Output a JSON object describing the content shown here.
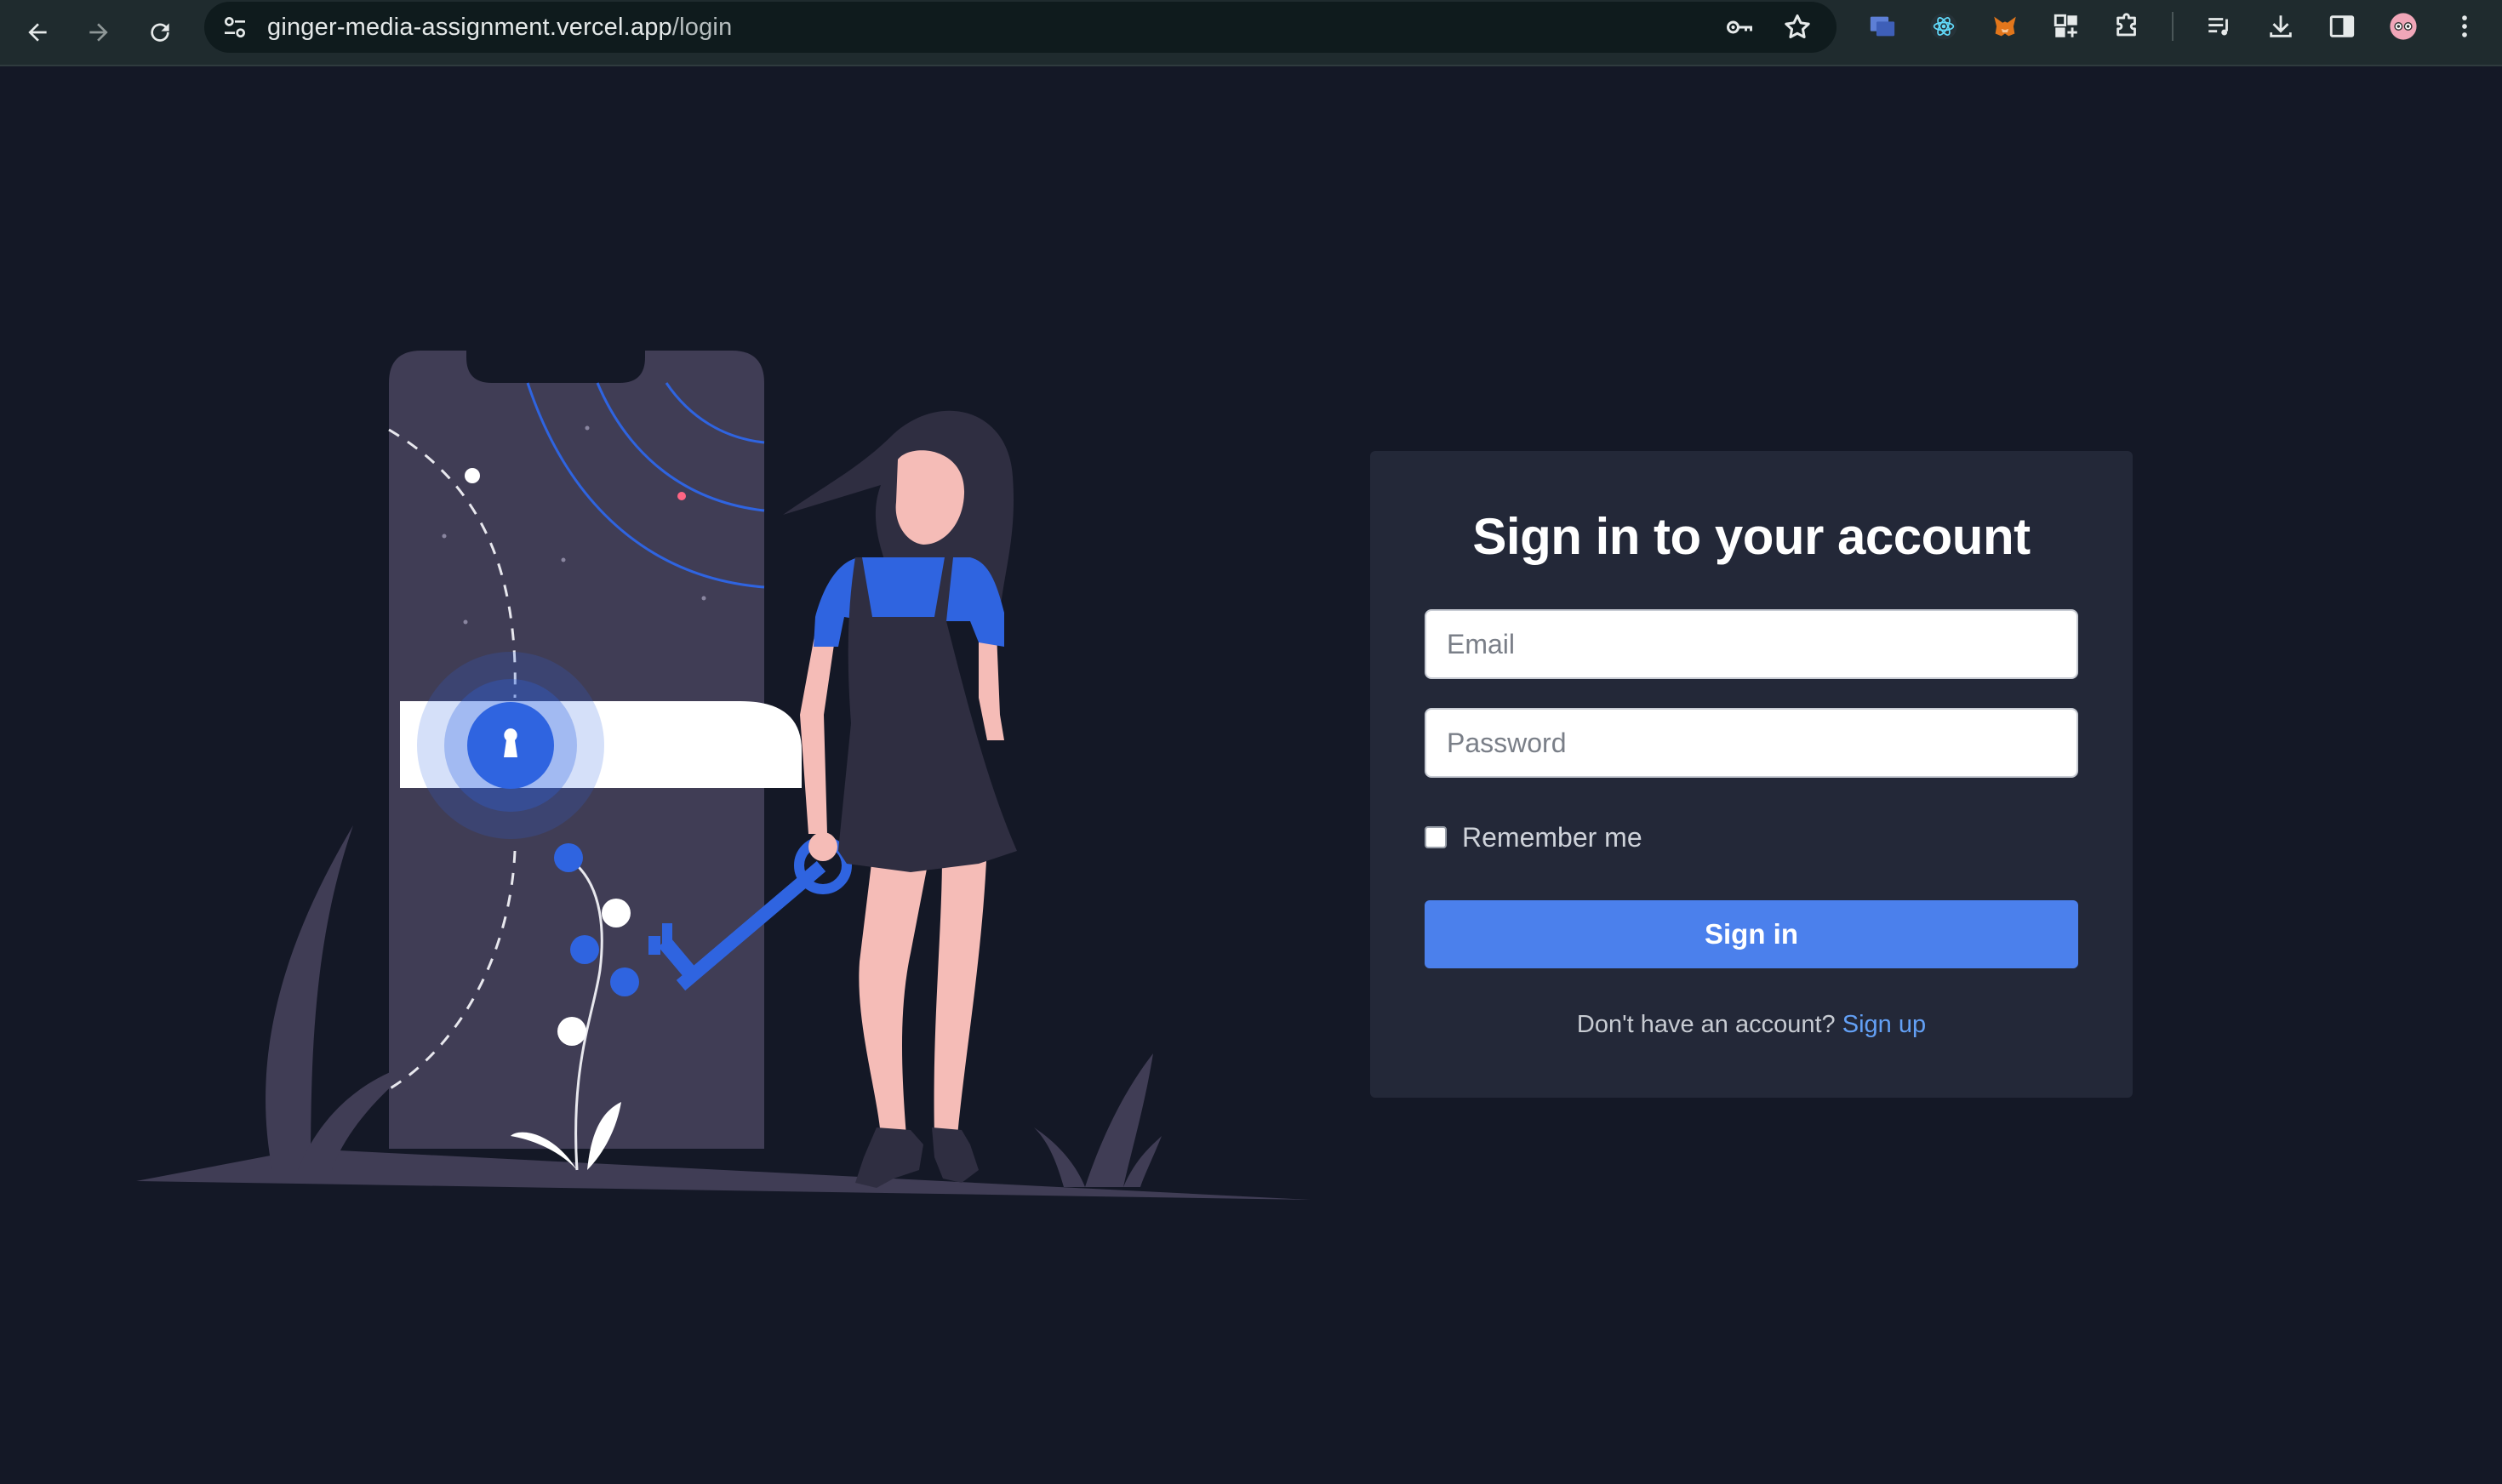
{
  "browser": {
    "url_host": "ginger-media-assignment.vercel.app",
    "url_path": "/login"
  },
  "login": {
    "title": "Sign in to your account",
    "email_placeholder": "Email",
    "password_placeholder": "Password",
    "remember_label": "Remember me",
    "remember_checked": false,
    "submit_label": "Sign in",
    "signup_prompt": "Don't have an account?",
    "signup_link": "Sign up"
  },
  "colors": {
    "page_bg": "#141826",
    "card_bg": "#232838",
    "accent": "#4b80ec",
    "link": "#63a0f5",
    "illustration_blue": "#2f64e0",
    "illustration_slate": "#403d55"
  },
  "icons": [
    "back-icon",
    "forward-icon",
    "reload-icon",
    "site-info-icon",
    "password-key-icon",
    "bookmark-star-icon",
    "extension-window-icon",
    "react-devtools-icon",
    "metamask-icon",
    "extension-grid-icon",
    "puzzle-icon",
    "media-control-icon",
    "download-icon",
    "side-panel-icon",
    "profile-avatar",
    "menu-dots-icon"
  ]
}
